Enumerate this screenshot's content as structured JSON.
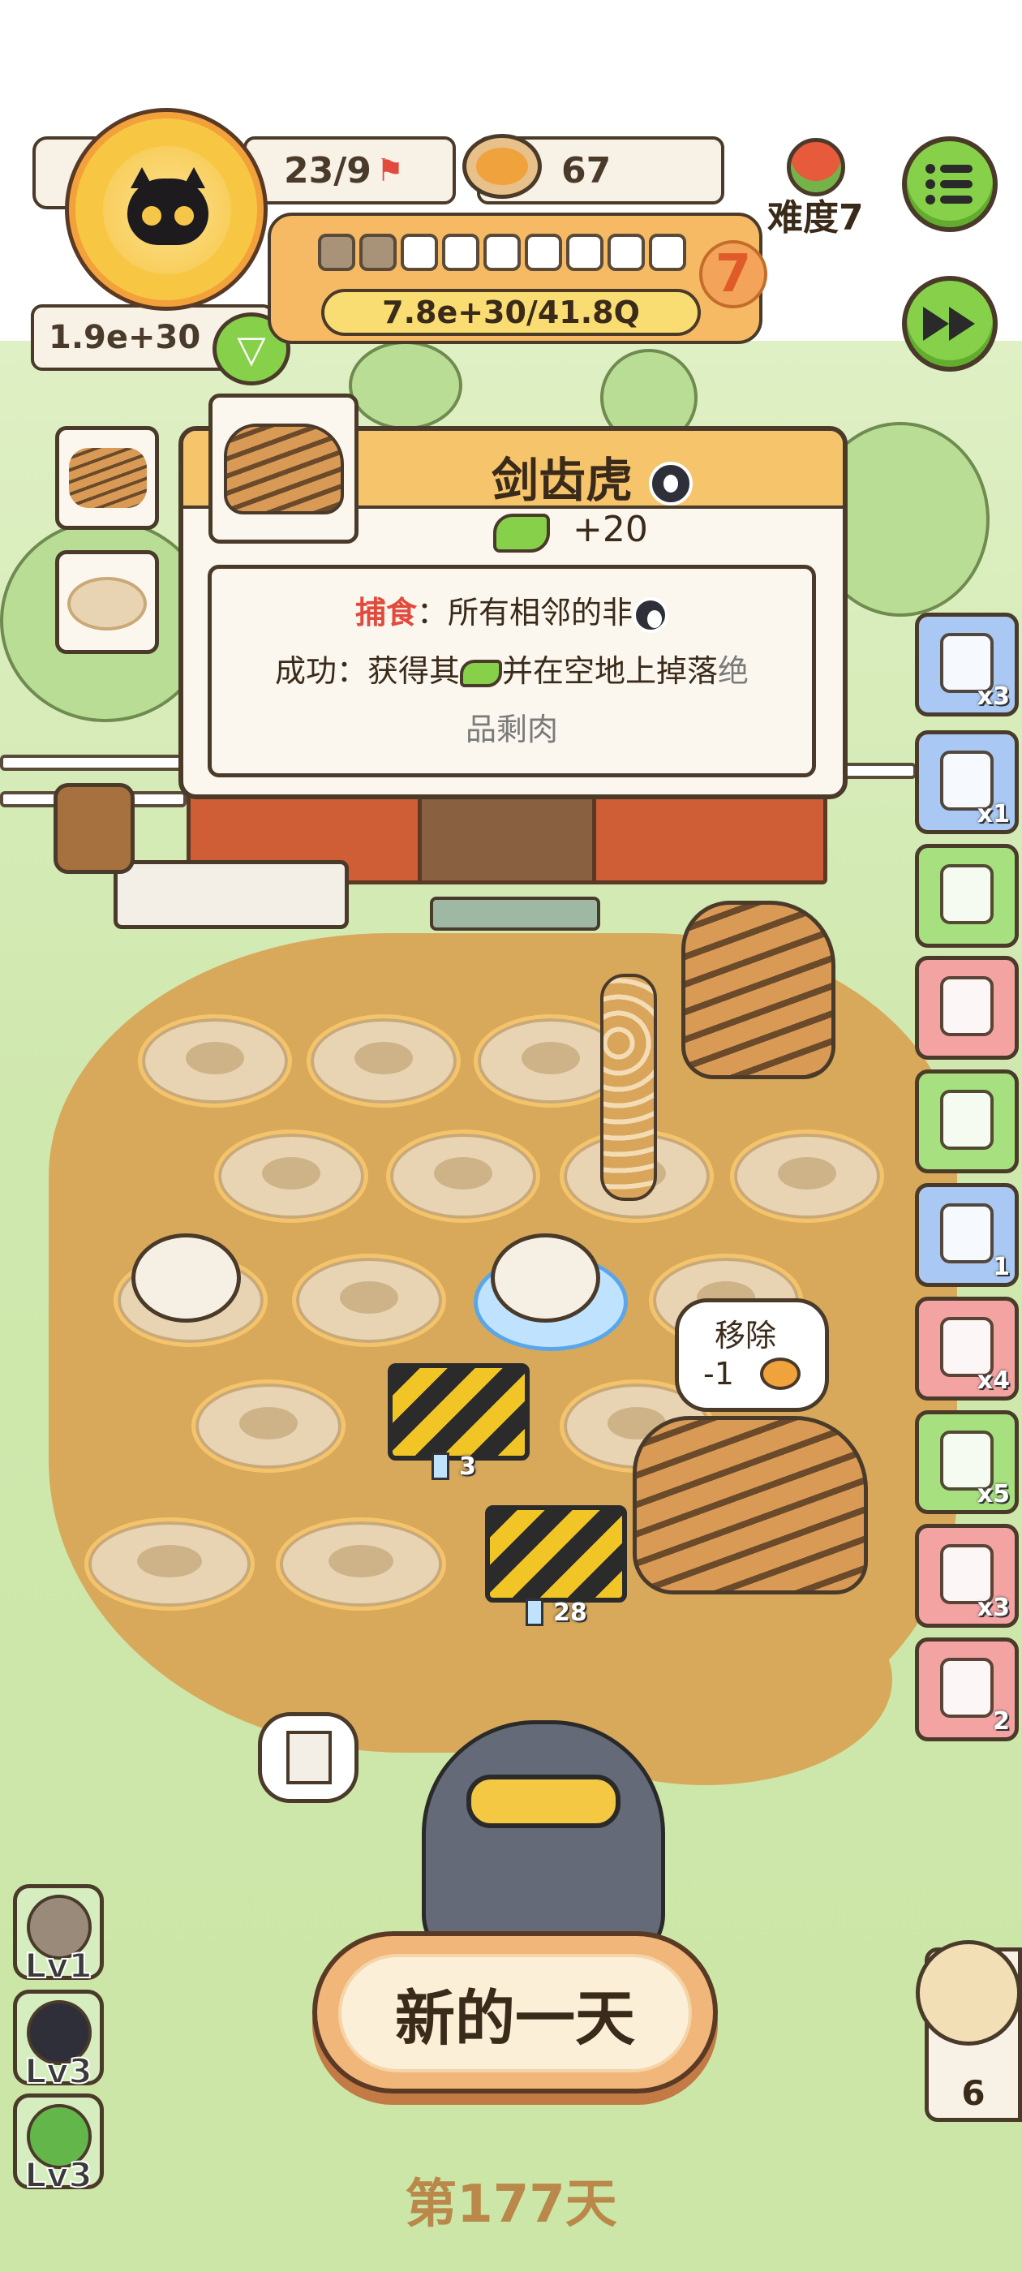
{
  "hud": {
    "capacity": "23/9",
    "coins": "67",
    "difficulty": "难度7",
    "money": "1.9e+30",
    "exp": "7.8e+30/41.8Q",
    "level": "7",
    "segments_filled": 2,
    "segments_total": 9
  },
  "buttons": {
    "menu_icon": "menu-icon",
    "fast_forward_icon": "fast-forward-icon",
    "new_day": "新的一天"
  },
  "tooltip": {
    "title": "剑齿虎",
    "reward": "+20",
    "ability_keyword": "捕食",
    "ability_text": "：所有相邻的非",
    "success_label": "成功：获得其",
    "success_text": "并在空地上掉落",
    "success_grey_1": "绝",
    "success_grey_2": "品剩肉"
  },
  "board": {
    "barrier_1_timer": "3",
    "barrier_2_timer": "28",
    "remove_label": "移除",
    "remove_cost": "-1"
  },
  "side_items": [
    {
      "name": "fire-herb",
      "count": "x3",
      "color": "#a9c9f4"
    },
    {
      "name": "charm-bag",
      "count": "x1",
      "color": "#a9c9f4"
    },
    {
      "name": "ticket",
      "count": "",
      "color": "#a6e07f"
    },
    {
      "name": "roast-rack",
      "count": "",
      "color": "#f4a3a3"
    },
    {
      "name": "credit-card",
      "count": "",
      "color": "#a6e07f"
    },
    {
      "name": "shovel",
      "count": "1",
      "color": "#a9c9f4"
    },
    {
      "name": "scroll",
      "count": "x4",
      "color": "#f4a3a3"
    },
    {
      "name": "coupon",
      "count": "x5",
      "color": "#a6e07f"
    },
    {
      "name": "pill-pack",
      "count": "x3",
      "color": "#f4a3a3"
    },
    {
      "name": "shop-sign",
      "count": "2",
      "color": "#f4a3a3"
    }
  ],
  "levels": [
    {
      "label": "Lv1",
      "color": "#9a8a7a"
    },
    {
      "label": "Lv3",
      "color": "#2f2f3a"
    },
    {
      "label": "Lv3",
      "color": "#63b64a"
    }
  ],
  "bird_count": "6",
  "day": "第177天"
}
